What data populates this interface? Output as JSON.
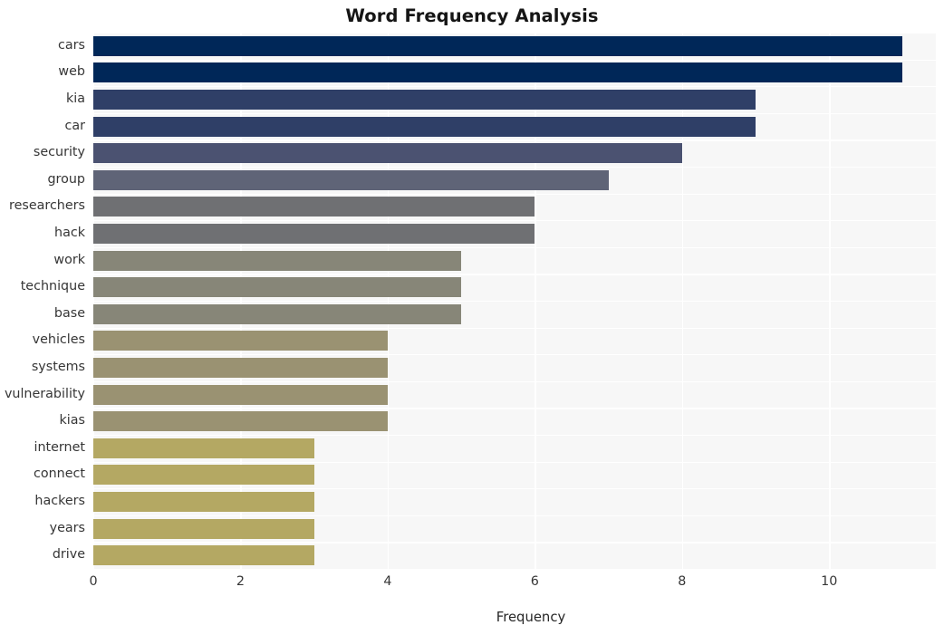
{
  "chart_data": {
    "type": "bar",
    "orientation": "horizontal",
    "title": "Word Frequency Analysis",
    "xlabel": "Frequency",
    "ylabel": "",
    "categories": [
      "cars",
      "web",
      "kia",
      "car",
      "security",
      "group",
      "researchers",
      "hack",
      "work",
      "technique",
      "base",
      "vehicles",
      "systems",
      "vulnerability",
      "kias",
      "internet",
      "connect",
      "hackers",
      "years",
      "drive"
    ],
    "values": [
      11,
      11,
      9,
      9,
      8,
      7,
      6,
      6,
      5,
      5,
      5,
      4,
      4,
      4,
      4,
      3,
      3,
      3,
      3,
      3
    ],
    "xlim": [
      0,
      11.45
    ],
    "xticks": [
      0,
      2,
      4,
      6,
      8,
      10
    ],
    "xtick_labels": [
      "0",
      "2",
      "4",
      "6",
      "8",
      "10"
    ],
    "grid": true,
    "legend": null,
    "bar_colors": [
      "#002758",
      "#002758",
      "#2f3f67",
      "#2f3f67",
      "#4b5271",
      "#5f6477",
      "#6f7073",
      "#6f7073",
      "#878678",
      "#878678",
      "#878678",
      "#9a9272",
      "#9a9272",
      "#9a9272",
      "#9a9272",
      "#b4a863",
      "#b4a863",
      "#b4a863",
      "#b4a863",
      "#b4a863"
    ],
    "plot_background": "#f7f7f7",
    "grid_color": "#ffffff",
    "figure_background": "#ffffff"
  }
}
